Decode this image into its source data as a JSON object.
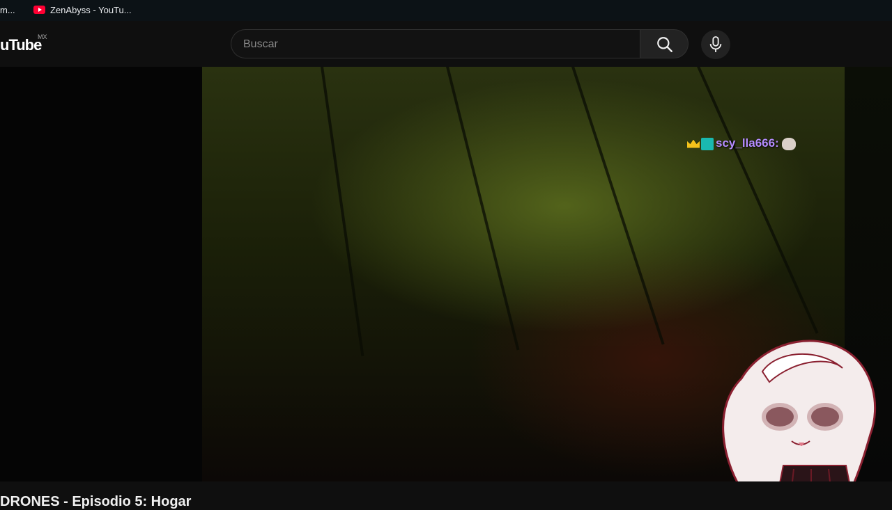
{
  "bookmarks": {
    "item_1": "m...",
    "item_2": "ZenAbyss - YouTu..."
  },
  "header": {
    "logo": "uTube",
    "region": "MX",
    "search_placeholder": "Buscar",
    "search_icon": "search-icon",
    "mic_icon": "mic-icon"
  },
  "overlay": {
    "chat_username": "scy_lla666:",
    "badges": [
      "crown-icon",
      "subscriber-badge-icon"
    ],
    "emote": "cat-emote-icon"
  },
  "video": {
    "title": "DRONES - Episodio 5: Hogar"
  }
}
